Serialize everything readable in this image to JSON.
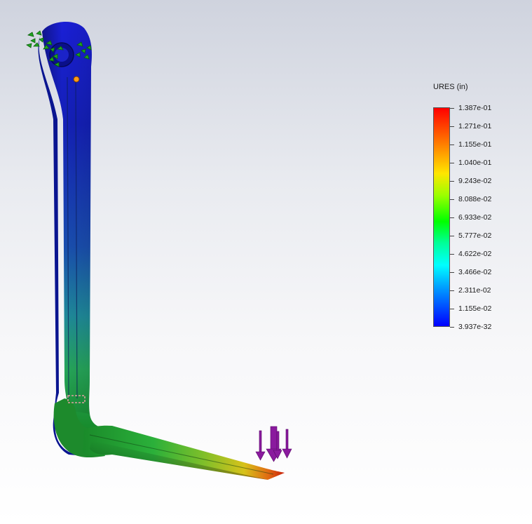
{
  "legend": {
    "title": "URES (in)",
    "labels": [
      "1.387e-01",
      "1.271e-01",
      "1.155e-01",
      "1.040e-01",
      "9.243e-02",
      "8.088e-02",
      "6.933e-02",
      "5.777e-02",
      "4.622e-02",
      "3.466e-02",
      "2.311e-02",
      "1.155e-02",
      "3.937e-32"
    ],
    "colors": [
      "#ff0000",
      "#ff7a00",
      "#ffe600",
      "#00ff00",
      "#00ffff",
      "#0000ff"
    ]
  },
  "model": {
    "fixture_icon": "fixture-arrows-icon",
    "load_icon": "force-arrows-icon",
    "probe_icon": "probe-point-icon"
  }
}
